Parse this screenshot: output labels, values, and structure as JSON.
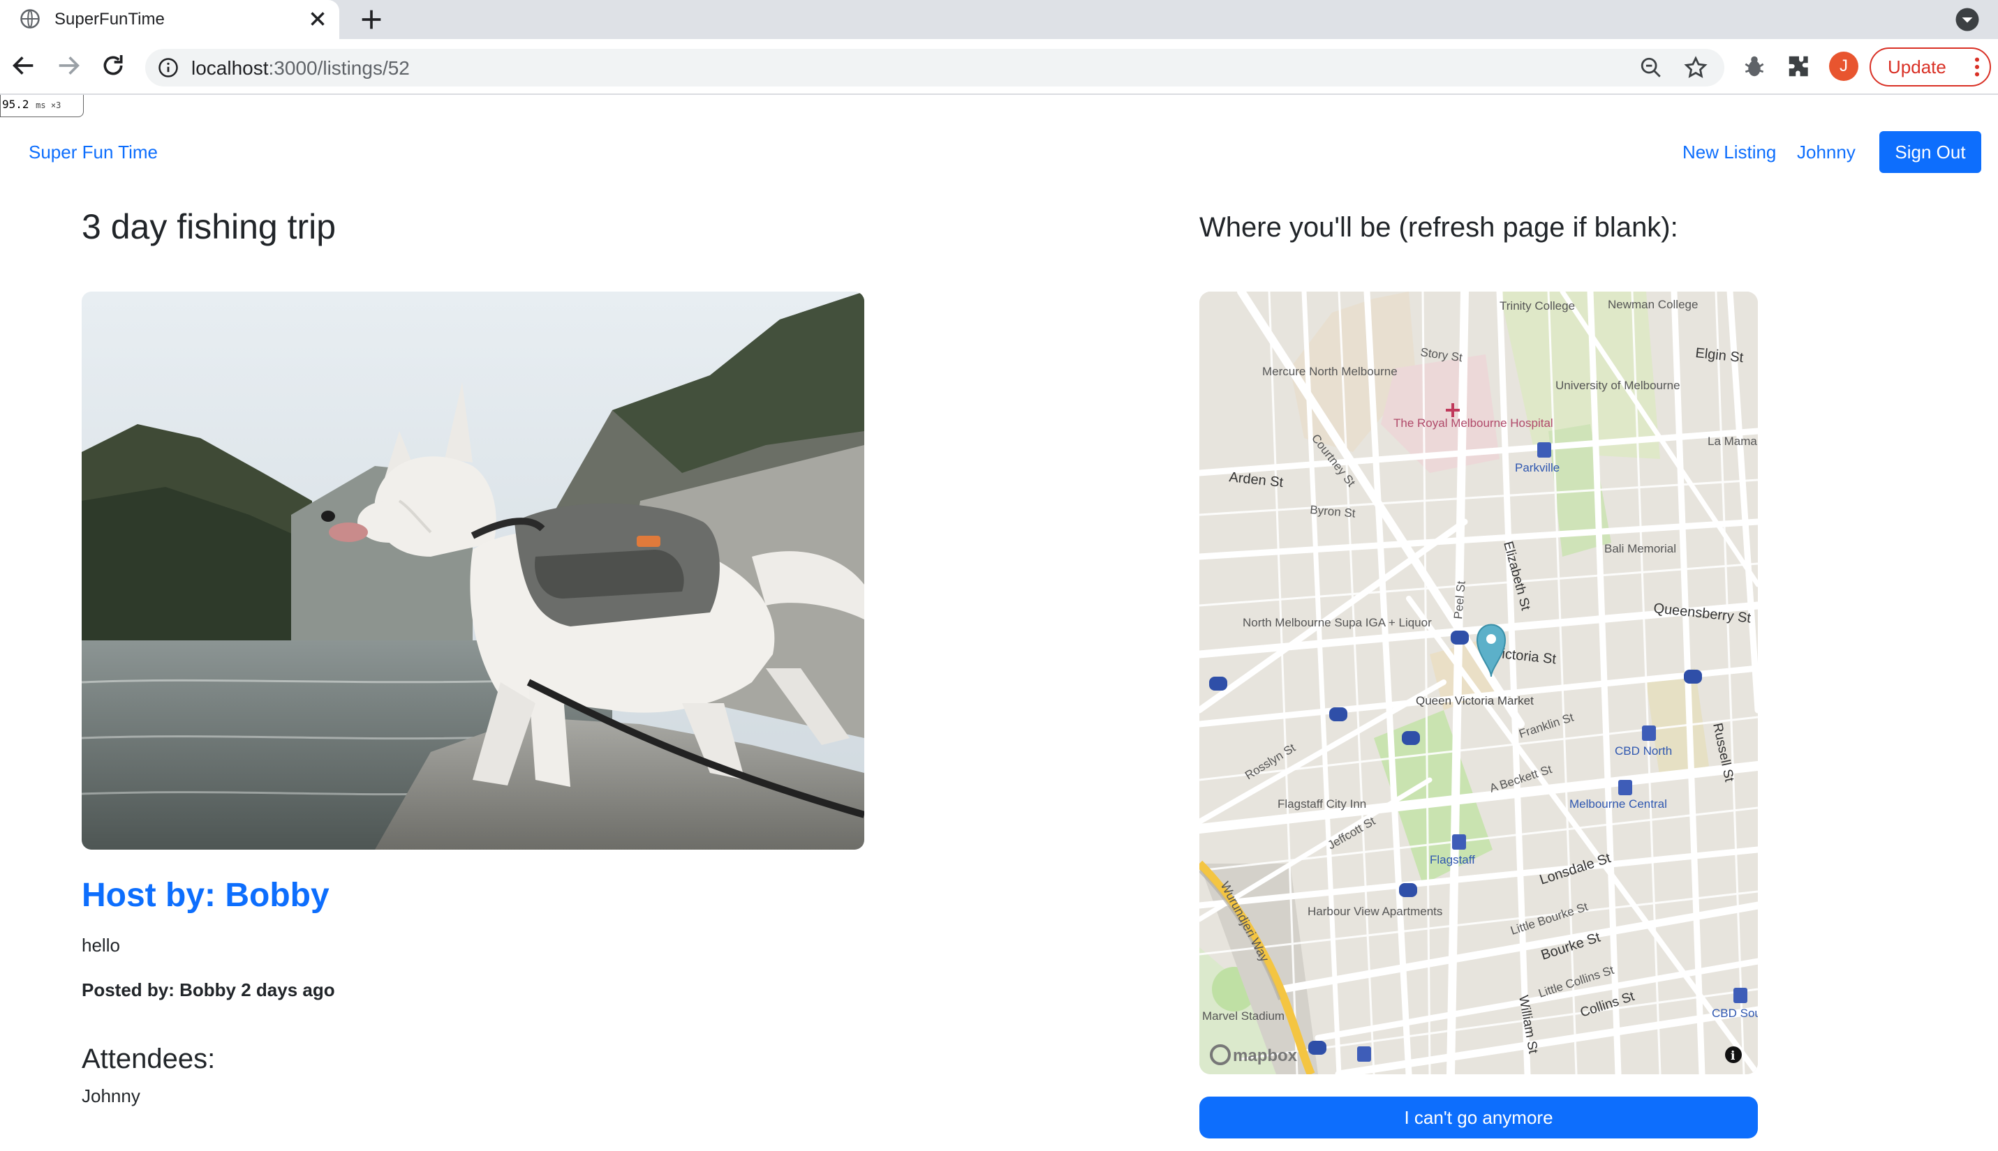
{
  "browser": {
    "tab_title": "SuperFunTime",
    "url_host": "localhost",
    "url_path": ":3000/listings/52",
    "profile_initial": "J",
    "update_label": "Update",
    "perf_value": "95.2",
    "perf_unit": "ms ×3"
  },
  "nav": {
    "brand": "Super Fun Time",
    "new_listing": "New Listing",
    "user": "Johnny",
    "sign_out": "Sign Out"
  },
  "listing": {
    "title": "3 day fishing trip",
    "host": "Host by: Bobby",
    "description": "hello",
    "posted_by": "Posted by: Bobby 2 days ago",
    "attendees_heading": "Attendees:",
    "attendees": [
      "Johnny"
    ]
  },
  "map": {
    "heading": "Where you'll be (refresh page if blank):",
    "attribution": "mapbox",
    "labels": {
      "trinity": "Trinity College",
      "newman": "Newman College",
      "story": "Story St",
      "elgin": "Elgin St",
      "mercure": "Mercure North Melbourne",
      "uni": "University of Melbourne",
      "hospital": "The Royal Melbourne Hospital",
      "courtney": "Courtney St",
      "parkville": "Parkville",
      "lamama": "La Mama",
      "arden": "Arden St",
      "byron": "Byron St",
      "bali": "Bali Memorial",
      "queensberry": "Queensberry St",
      "peel": "Peel St",
      "elizabeth": "Elizabeth St",
      "nm_iga": "North Melbourne Supa IGA + Liquor",
      "victoria": "Victoria St",
      "qvm": "Queen Victoria Market",
      "franklin": "Franklin St",
      "cbd_north": "CBD North",
      "rosslyn": "Rosslyn St",
      "abeckett": "A Beckett St",
      "flagstaff_inn": "Flagstaff City Inn",
      "melb_central": "Melbourne Central",
      "jeffcott": "Jeffcott St",
      "flagstaff": "Flagstaff",
      "lonsdale": "Lonsdale St",
      "harbour": "Harbour View Apartments",
      "little_bourke": "Little Bourke St",
      "bourke": "Bourke St",
      "little_collins": "Little Collins St",
      "collins": "Collins St",
      "william": "William St",
      "stadium": "Marvel Stadium",
      "wurundjeri": "Wurundjeri Way",
      "russell": "Russell St",
      "cbd_south": "CBD South"
    }
  },
  "actions": {
    "cant_go": "I can't go anymore"
  },
  "colors": {
    "primary": "#0d6efd",
    "chrome": "#dee1e6",
    "update_red": "#d93025",
    "marker": "#5cb0c9"
  }
}
